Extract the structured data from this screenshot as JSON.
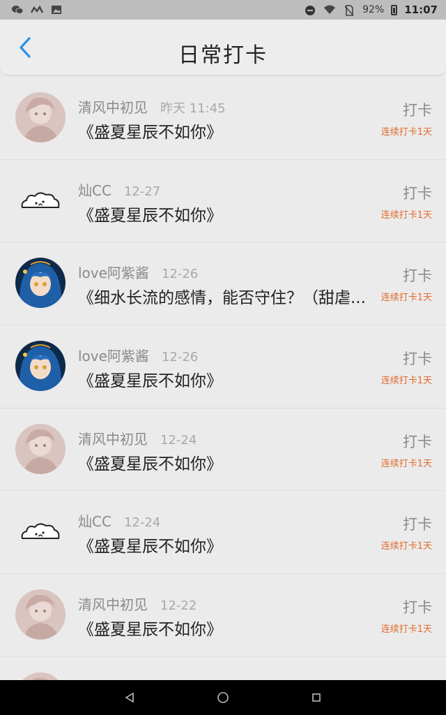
{
  "status_bar": {
    "battery_text": "92%",
    "time": "11:07"
  },
  "header": {
    "title": "日常打卡"
  },
  "colors": {
    "accent": "#2b8fe6",
    "streak": "#e26a2c"
  },
  "items": [
    {
      "username": "清风中初见",
      "time": "昨天 11:45",
      "book": "《盛夏星辰不如你》",
      "checkin": "打卡",
      "streak": "连续打卡1天",
      "avatar": "avatar-girl-sketch"
    },
    {
      "username": "灿CC",
      "time": "12-27",
      "book": "《盛夏星辰不如你》",
      "checkin": "打卡",
      "streak": "连续打卡1天",
      "avatar": "avatar-doodle-creature"
    },
    {
      "username": "love阿紫酱",
      "time": "12-26",
      "book": "《细水长流的感情，能否守住？（甜虐...",
      "checkin": "打卡",
      "streak": "连续打卡1天",
      "avatar": "avatar-anime-blue-hair"
    },
    {
      "username": "love阿紫酱",
      "time": "12-26",
      "book": "《盛夏星辰不如你》",
      "checkin": "打卡",
      "streak": "连续打卡1天",
      "avatar": "avatar-anime-blue-hair"
    },
    {
      "username": "清风中初见",
      "time": "12-24",
      "book": "《盛夏星辰不如你》",
      "checkin": "打卡",
      "streak": "连续打卡1天",
      "avatar": "avatar-girl-sketch"
    },
    {
      "username": "灿CC",
      "time": "12-24",
      "book": "《盛夏星辰不如你》",
      "checkin": "打卡",
      "streak": "连续打卡1天",
      "avatar": "avatar-doodle-creature"
    },
    {
      "username": "清风中初见",
      "time": "12-22",
      "book": "《盛夏星辰不如你》",
      "checkin": "打卡",
      "streak": "连续打卡1天",
      "avatar": "avatar-girl-sketch"
    }
  ]
}
